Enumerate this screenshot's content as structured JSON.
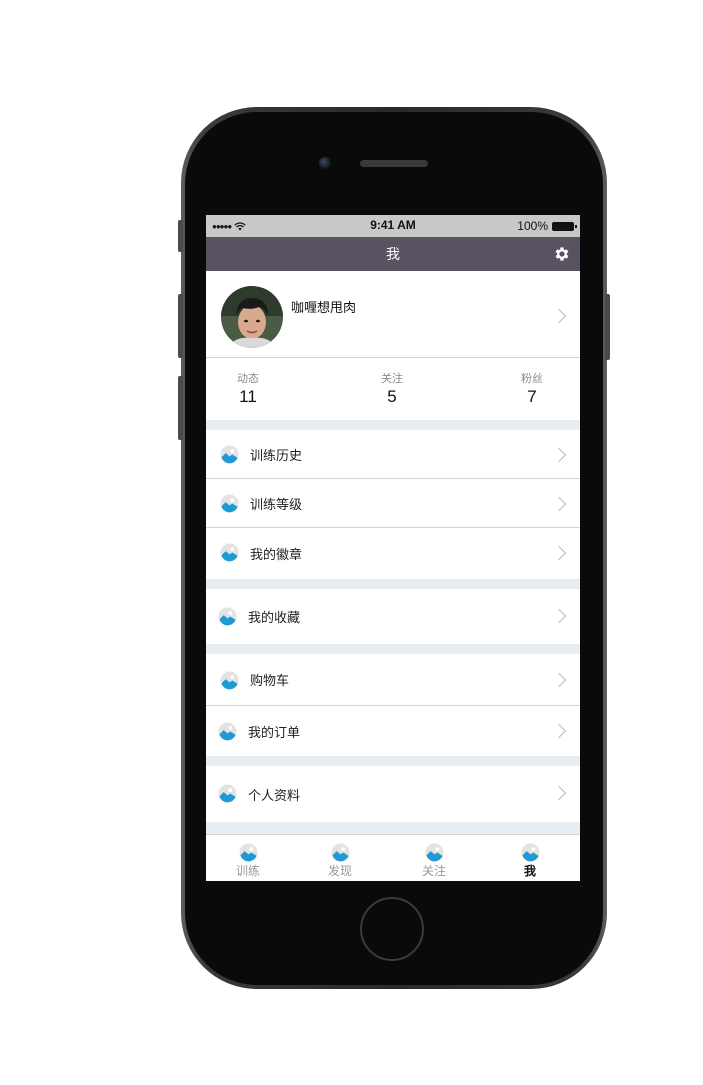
{
  "status_bar": {
    "signal": "●●●●●",
    "time": "9:41 AM",
    "battery": "100%"
  },
  "nav": {
    "title": "我",
    "settings_icon": "gear-icon"
  },
  "profile": {
    "name": "咖喱想甩肉"
  },
  "stats": [
    {
      "label": "动态",
      "value": "11"
    },
    {
      "label": "关注",
      "value": "5"
    },
    {
      "label": "粉丝",
      "value": "7"
    }
  ],
  "menu": {
    "training_history": "训练历史",
    "training_level": "训练等级",
    "my_badges": "我的徽章",
    "my_favorites": "我的收藏",
    "cart": "购物车",
    "my_orders": "我的订单",
    "personal_info": "个人资料"
  },
  "tabs": [
    {
      "label": "训练"
    },
    {
      "label": "发现"
    },
    {
      "label": "关注"
    },
    {
      "label": "我"
    }
  ],
  "colors": {
    "nav_bg": "#5a5161",
    "icon_blue": "#1e9ad6",
    "page_bg": "#e7edf1"
  }
}
